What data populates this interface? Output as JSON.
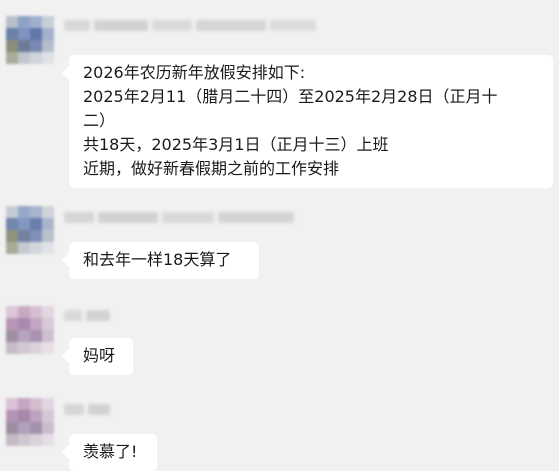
{
  "chat": {
    "messages": [
      {
        "avatar": "blurred-avatar",
        "sender": "",
        "lines": [
          "2026年农历新年放假安排如下:",
          "2025年2月11（腊月二十四）至2025年2月28日（正月十",
          "二）",
          "共18天，2025年3月1日（正月十三）上班",
          "近期，做好新春假期之前的工作安排"
        ]
      },
      {
        "avatar": "blurred-avatar",
        "sender": "",
        "lines": [
          "和去年一样18天算了"
        ]
      },
      {
        "avatar": "blurred-avatar",
        "sender": "",
        "lines": [
          "妈呀"
        ]
      },
      {
        "avatar": "blurred-avatar",
        "sender": "",
        "lines": [
          "羡慕了!"
        ]
      }
    ]
  },
  "colors": {
    "background": "#f1f1f1",
    "bubble": "#ffffff",
    "text": "#1a1a1a"
  }
}
